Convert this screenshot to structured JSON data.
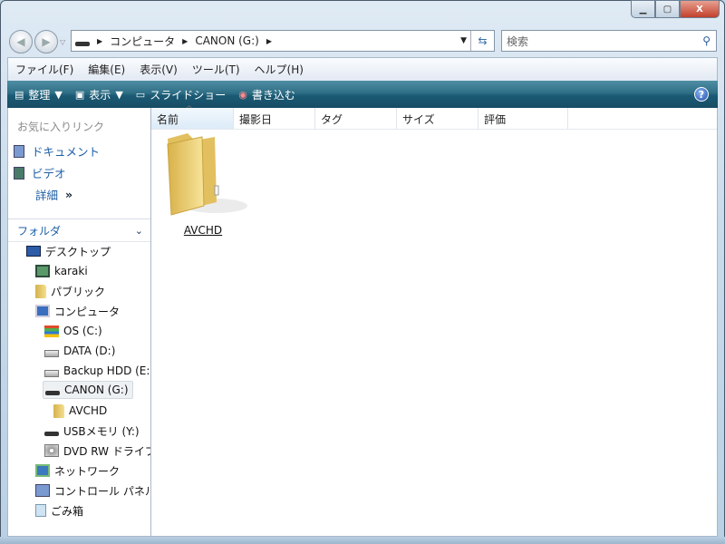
{
  "window": {
    "minimize": "▁",
    "maximize": "▢",
    "close": "X"
  },
  "address": {
    "segments": [
      "コンピュータ",
      "CANON (G:)"
    ]
  },
  "search": {
    "placeholder": "検索"
  },
  "menu": [
    "ファイル(F)",
    "編集(E)",
    "表示(V)",
    "ツール(T)",
    "ヘルプ(H)"
  ],
  "toolbar": {
    "organize": "整理",
    "views": "表示",
    "slideshow": "スライドショー",
    "burn": "書き込む",
    "help": "?"
  },
  "favorites": {
    "title": "お気に入りリンク",
    "items": [
      "ドキュメント",
      "ビデオ"
    ],
    "more": "詳細"
  },
  "folders": {
    "title": "フォルダ",
    "tree": [
      "デスクトップ",
      "karaki",
      "パブリック",
      "コンピュータ",
      "OS (C:)",
      "DATA (D:)",
      "Backup HDD (E:)",
      "CANON (G:)",
      "AVCHD",
      "USBメモリ (Y:)",
      "DVD RW ドライブ",
      "ネットワーク",
      "コントロール パネル",
      "ごみ箱"
    ]
  },
  "columns": [
    "名前",
    "撮影日",
    "タグ",
    "サイズ",
    "評価"
  ],
  "files": [
    {
      "name": "AVCHD"
    }
  ]
}
